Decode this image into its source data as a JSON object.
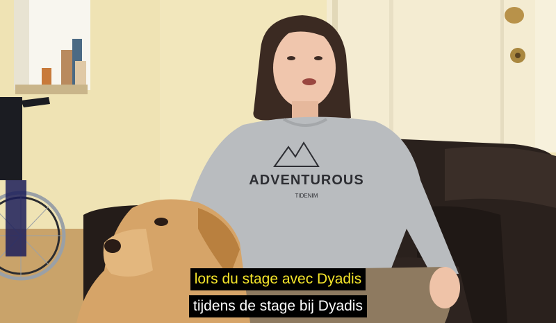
{
  "subtitles": [
    {
      "text": "lors du stage avec Dyadis",
      "color": "#f5e52a"
    },
    {
      "text": "tijdens de stage bij Dyadis",
      "color": "#ffffff"
    }
  ],
  "sweatshirt": {
    "brand": "ADVENTUROUS",
    "subtext": "TIDENIM"
  },
  "colors": {
    "wall": "#efe3b4",
    "sofa": "#2a211d",
    "sweater": "#b9bcbf",
    "dog": "#d6a468",
    "door": "#f4ecd2"
  }
}
